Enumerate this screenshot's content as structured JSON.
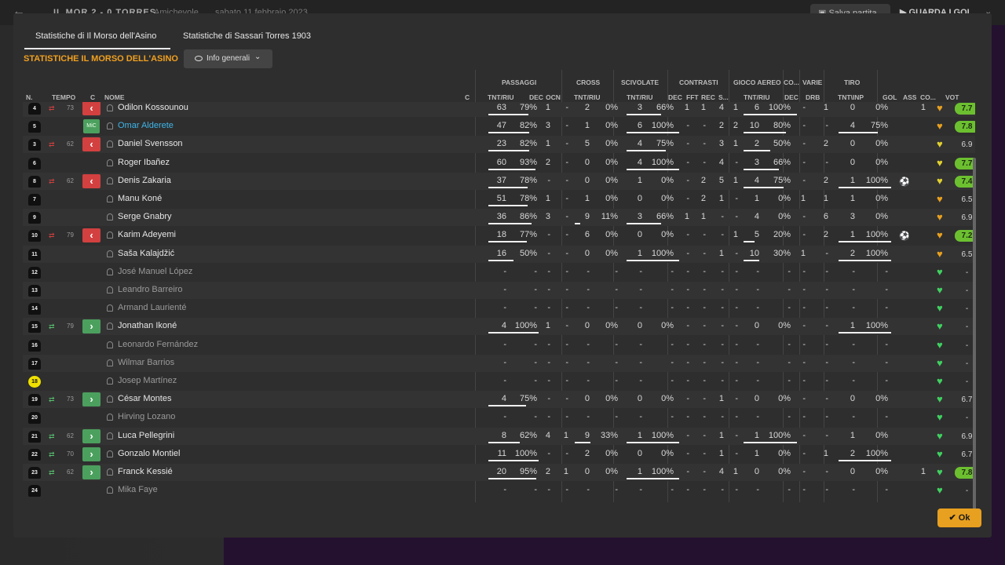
{
  "topbar": {
    "score": "IL MOR  2 - 0  TORRES",
    "subtitle": "Amichevole",
    "date": "sabato 11 febbraio 2023",
    "save": "Salva partita",
    "watch": "GUARDA I GOL"
  },
  "tabs": [
    "Statistiche di Il Morso dell'Asino",
    "Statistiche di Sassari Torres 1903"
  ],
  "section_title": "STATISTICHE IL MORSO DELL'ASINO",
  "view_dropdown": "Info generali",
  "headers": {
    "groups": {
      "passaggi": "PASSAGGI",
      "cross": "CROSS",
      "scivolate": "SCIVOLATE",
      "contrasti": "CONTRASTI",
      "gioco_aereo": "GIOCO AEREO",
      "co": "CO...",
      "varie": "VARIE",
      "tiro": "TIRO"
    },
    "cols": {
      "n": "N.",
      "tempo": "TEMPO",
      "c": "C",
      "nome": "NOME",
      "c2": "C",
      "tnt_riu": "TNT/RIU",
      "dec": "DEC",
      "ocn": "OCN",
      "fft": "FFT",
      "rec": "REC",
      "s": "S...",
      "drb": "DRB",
      "tnt_inp": "TNT\\INP",
      "gol": "GOL",
      "ass": "ASS",
      "co2": "CO...",
      "vot": "VOT"
    }
  },
  "players": [
    {
      "n": "4",
      "tempo": "73",
      "sub": "out",
      "name": "Odilon Kossounou",
      "stats": [
        "63",
        "79%",
        "1",
        "-",
        "2",
        "0%",
        "3",
        "66%",
        "1",
        "1",
        "4",
        "1",
        "6",
        "100%",
        "-",
        "1",
        "0",
        "0%",
        "",
        "1"
      ],
      "bars": [
        0.79,
        0,
        0.66,
        1,
        0
      ],
      "heart": "#e8a020",
      "rating": "7.7",
      "good": true,
      "dim": false
    },
    {
      "n": "5",
      "pos": "MiC",
      "name": "Omar Alderete",
      "link": true,
      "stats": [
        "47",
        "82%",
        "3",
        "-",
        "1",
        "0%",
        "6",
        "100%",
        "-",
        "-",
        "2",
        "2",
        "10",
        "80%",
        "-",
        "-",
        "4",
        "75%",
        "",
        ""
      ],
      "bars": [
        0.82,
        0,
        1,
        0.8,
        0.75
      ],
      "heart": "#e8a020",
      "rating": "7.8",
      "good": true
    },
    {
      "n": "3",
      "tempo": "62",
      "sub": "out",
      "name": "Daniel Svensson",
      "stats": [
        "23",
        "82%",
        "1",
        "-",
        "5",
        "0%",
        "4",
        "75%",
        "-",
        "-",
        "3",
        "1",
        "2",
        "50%",
        "-",
        "2",
        "0",
        "0%",
        "",
        ""
      ],
      "bars": [
        0.82,
        0,
        0.75,
        0.5,
        0
      ],
      "heart": "#e0d030",
      "rating": "6.9",
      "good": false
    },
    {
      "n": "6",
      "name": "Roger Ibañez",
      "stats": [
        "60",
        "93%",
        "2",
        "-",
        "0",
        "0%",
        "4",
        "100%",
        "-",
        "-",
        "4",
        "-",
        "3",
        "66%",
        "-",
        "-",
        "0",
        "0%",
        "",
        ""
      ],
      "bars": [
        0.93,
        0,
        1,
        0.66,
        0
      ],
      "heart": "#e0d030",
      "rating": "7.7",
      "good": true
    },
    {
      "n": "8",
      "tempo": "62",
      "sub": "out",
      "name": "Denis Zakaria",
      "stats": [
        "37",
        "78%",
        "-",
        "-",
        "0",
        "0%",
        "1",
        "0%",
        "-",
        "2",
        "5",
        "1",
        "4",
        "75%",
        "-",
        "2",
        "1",
        "100%",
        "gol",
        ""
      ],
      "bars": [
        0.78,
        0,
        0,
        0.75,
        1
      ],
      "heart": "#e0d030",
      "rating": "7.4",
      "good": true
    },
    {
      "n": "7",
      "name": "Manu Koné",
      "stats": [
        "51",
        "78%",
        "1",
        "-",
        "1",
        "0%",
        "0",
        "0%",
        "-",
        "2",
        "1",
        "-",
        "1",
        "0%",
        "1",
        "1",
        "1",
        "0%",
        "",
        ""
      ],
      "bars": [
        0.78,
        0,
        0,
        0,
        0
      ],
      "heart": "#e8a020",
      "rating": "6.5",
      "good": false
    },
    {
      "n": "9",
      "name": "Serge Gnabry",
      "stats": [
        "36",
        "86%",
        "3",
        "-",
        "9",
        "11%",
        "3",
        "66%",
        "1",
        "1",
        "-",
        "-",
        "4",
        "0%",
        "-",
        "6",
        "3",
        "0%",
        "",
        ""
      ],
      "bars": [
        0.86,
        0.11,
        0.66,
        0,
        0
      ],
      "heart": "#e8a020",
      "rating": "6.9",
      "good": false
    },
    {
      "n": "10",
      "tempo": "79",
      "sub": "out",
      "name": "Karim Adeyemi",
      "stats": [
        "18",
        "77%",
        "-",
        "-",
        "6",
        "0%",
        "0",
        "0%",
        "-",
        "-",
        "-",
        "1",
        "5",
        "20%",
        "-",
        "2",
        "1",
        "100%",
        "gol",
        ""
      ],
      "bars": [
        0.77,
        0,
        0,
        0.2,
        1
      ],
      "heart": "#e8a020",
      "rating": "7.2",
      "good": true
    },
    {
      "n": "11",
      "name": "Saša Kalajdžić",
      "stats": [
        "16",
        "50%",
        "-",
        "-",
        "0",
        "0%",
        "1",
        "100%",
        "-",
        "-",
        "1",
        "-",
        "10",
        "30%",
        "1",
        "-",
        "2",
        "100%",
        "",
        ""
      ],
      "bars": [
        0.5,
        0,
        1,
        0.3,
        1
      ],
      "heart": "#e8a020",
      "rating": "6.5",
      "good": false
    },
    {
      "n": "12",
      "name": "José Manuel López",
      "dim": true,
      "stats": [
        "-",
        "-",
        "-",
        "-",
        "-",
        "-",
        "-",
        "-",
        "-",
        "-",
        "-",
        "-",
        "-",
        "-",
        "-",
        "-",
        "-",
        "-",
        "",
        ""
      ],
      "bars": [
        0,
        0,
        0,
        0,
        0
      ],
      "heart": "#40d060",
      "rating": "-",
      "good": false
    },
    {
      "n": "13",
      "name": "Leandro Barreiro",
      "dim": true,
      "stats": [
        "-",
        "-",
        "-",
        "-",
        "-",
        "-",
        "-",
        "-",
        "-",
        "-",
        "-",
        "-",
        "-",
        "-",
        "-",
        "-",
        "-",
        "-",
        "",
        ""
      ],
      "bars": [
        0,
        0,
        0,
        0,
        0
      ],
      "heart": "#40d060",
      "rating": "-",
      "good": false
    },
    {
      "n": "14",
      "name": "Armand Laurienté",
      "dim": true,
      "stats": [
        "-",
        "-",
        "-",
        "-",
        "-",
        "-",
        "-",
        "-",
        "-",
        "-",
        "-",
        "-",
        "-",
        "-",
        "-",
        "-",
        "-",
        "-",
        "",
        ""
      ],
      "bars": [
        0,
        0,
        0,
        0,
        0
      ],
      "heart": "#40d060",
      "rating": "-",
      "good": false
    },
    {
      "n": "15",
      "tempo": "79",
      "sub": "in",
      "name": "Jonathan Ikoné",
      "stats": [
        "4",
        "100%",
        "1",
        "-",
        "0",
        "0%",
        "0",
        "0%",
        "-",
        "-",
        "-",
        "-",
        "0",
        "0%",
        "-",
        "-",
        "1",
        "100%",
        "",
        ""
      ],
      "bars": [
        1,
        0,
        0,
        0,
        1
      ],
      "heart": "#40d060",
      "rating": "-",
      "good": false
    },
    {
      "n": "16",
      "name": "Leonardo Fernández",
      "dim": true,
      "stats": [
        "-",
        "-",
        "-",
        "-",
        "-",
        "-",
        "-",
        "-",
        "-",
        "-",
        "-",
        "-",
        "-",
        "-",
        "-",
        "-",
        "-",
        "-",
        "",
        ""
      ],
      "bars": [
        0,
        0,
        0,
        0,
        0
      ],
      "heart": "#40d060",
      "rating": "-",
      "good": false
    },
    {
      "n": "17",
      "name": "Wilmar Barrios",
      "dim": true,
      "stats": [
        "-",
        "-",
        "-",
        "-",
        "-",
        "-",
        "-",
        "-",
        "-",
        "-",
        "-",
        "-",
        "-",
        "-",
        "-",
        "-",
        "-",
        "-",
        "",
        ""
      ],
      "bars": [
        0,
        0,
        0,
        0,
        0
      ],
      "heart": "#40d060",
      "rating": "-",
      "good": false
    },
    {
      "n": "18",
      "gk": true,
      "name": "Josep Martínez",
      "dim": true,
      "stats": [
        "-",
        "-",
        "-",
        "-",
        "-",
        "-",
        "-",
        "-",
        "-",
        "-",
        "-",
        "-",
        "-",
        "-",
        "-",
        "-",
        "-",
        "-",
        "",
        ""
      ],
      "bars": [
        0,
        0,
        0,
        0,
        0
      ],
      "heart": "#40d060",
      "rating": "-",
      "good": false
    },
    {
      "n": "19",
      "tempo": "73",
      "sub": "in",
      "name": "César Montes",
      "stats": [
        "4",
        "75%",
        "-",
        "-",
        "0",
        "0%",
        "0",
        "0%",
        "-",
        "-",
        "1",
        "-",
        "0",
        "0%",
        "-",
        "-",
        "0",
        "0%",
        "",
        ""
      ],
      "bars": [
        0.75,
        0,
        0,
        0,
        0
      ],
      "heart": "#40d060",
      "rating": "6.7",
      "good": false
    },
    {
      "n": "20",
      "name": "Hirving Lozano",
      "dim": true,
      "stats": [
        "-",
        "-",
        "-",
        "-",
        "-",
        "-",
        "-",
        "-",
        "-",
        "-",
        "-",
        "-",
        "-",
        "-",
        "-",
        "-",
        "-",
        "-",
        "",
        ""
      ],
      "bars": [
        0,
        0,
        0,
        0,
        0
      ],
      "heart": "#40d060",
      "rating": "-",
      "good": false
    },
    {
      "n": "21",
      "tempo": "62",
      "sub": "in",
      "name": "Luca Pellegrini",
      "stats": [
        "8",
        "62%",
        "4",
        "1",
        "9",
        "33%",
        "1",
        "100%",
        "-",
        "-",
        "1",
        "-",
        "1",
        "100%",
        "-",
        "-",
        "1",
        "0%",
        "",
        ""
      ],
      "bars": [
        0.62,
        0.33,
        1,
        1,
        0
      ],
      "heart": "#40d060",
      "rating": "6.9",
      "good": false
    },
    {
      "n": "22",
      "tempo": "70",
      "sub": "in",
      "name": "Gonzalo Montiel",
      "stats": [
        "11",
        "100%",
        "-",
        "-",
        "2",
        "0%",
        "0",
        "0%",
        "-",
        "-",
        "1",
        "-",
        "1",
        "0%",
        "-",
        "1",
        "2",
        "100%",
        "",
        ""
      ],
      "bars": [
        1,
        0,
        0,
        0,
        1
      ],
      "heart": "#40d060",
      "rating": "6.7",
      "good": false
    },
    {
      "n": "23",
      "tempo": "62",
      "sub": "in",
      "name": "Franck Kessié",
      "stats": [
        "20",
        "95%",
        "2",
        "1",
        "0",
        "0%",
        "1",
        "100%",
        "-",
        "-",
        "4",
        "1",
        "0",
        "0%",
        "-",
        "-",
        "0",
        "0%",
        "",
        "1"
      ],
      "bars": [
        0.95,
        0,
        1,
        0,
        0
      ],
      "heart": "#40d060",
      "rating": "7.8",
      "good": true
    },
    {
      "n": "24",
      "name": "Mika Faye",
      "dim": true,
      "stats": [
        "-",
        "-",
        "-",
        "-",
        "-",
        "-",
        "-",
        "-",
        "-",
        "-",
        "-",
        "-",
        "-",
        "-",
        "-",
        "-",
        "-",
        "-",
        "",
        ""
      ],
      "bars": [
        0,
        0,
        0,
        0,
        0
      ],
      "heart": "#40d060",
      "rating": "-",
      "good": false
    }
  ],
  "ok": "Ok"
}
